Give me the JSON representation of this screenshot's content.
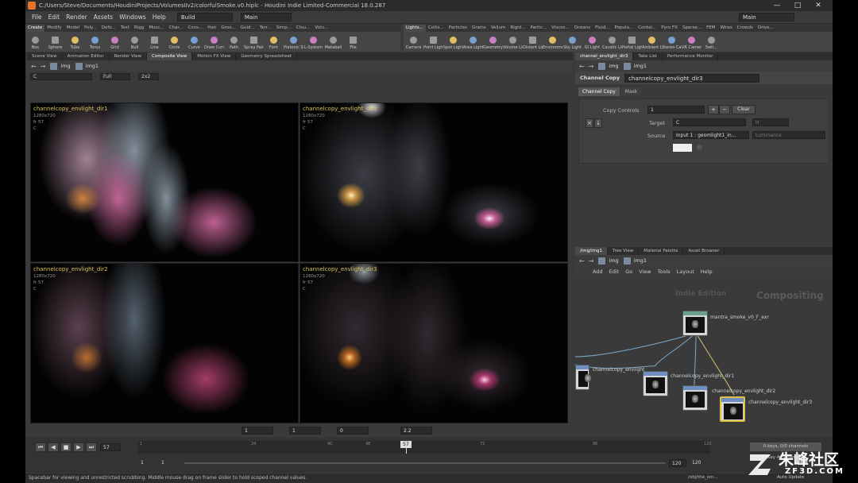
{
  "window": {
    "title": "C:/Users/Steve/Documents/HoudiniProjects/VolumesIIv2/colorfulSmoke.v0.hiplc - Houdini Indie Limited-Commercial 18.0.287",
    "minimize": "—",
    "maximize": "□",
    "close": "✕"
  },
  "menu": [
    "File",
    "Edit",
    "Render",
    "Assets",
    "Windows",
    "Help"
  ],
  "desktop_select": "Build",
  "main_select": "Main",
  "right_main": "Main",
  "shelf_left_tabs": [
    "Create",
    "Modify",
    "Model",
    "Poly...",
    "Defo...",
    "Text",
    "Rigg",
    "Musc...",
    "Char...",
    "Cons...",
    "Hair",
    "Groo...",
    "Guid...",
    "Terr...",
    "Simp...",
    "Clou...",
    "Volu..."
  ],
  "shelf_left_tools": [
    "Box",
    "Sphere",
    "Tube",
    "Torus",
    "Grid",
    "Null",
    "Line",
    "Circle",
    "Curve",
    "Draw Curve",
    "Path",
    "Spray Paint",
    "Font",
    "Platonic Solids",
    "L-System",
    "Metaball",
    "File"
  ],
  "shelf_right_tabs": [
    "Lights...",
    "Collis...",
    "Particles",
    "Grains",
    "Vellum",
    "Rigid...",
    "Partic...",
    "Viscos...",
    "Oceans",
    "Fluid...",
    "Popula...",
    "Contai...",
    "Pyro FX",
    "Sparse...",
    "FEM",
    "Wires",
    "Crowds",
    "Drive..."
  ],
  "shelf_right_tools": [
    "Camera",
    "Point Light",
    "Spot Light",
    "Area Light",
    "Geometry Light",
    "Volume Light",
    "Distant Light",
    "Environment Light",
    "Sky Light",
    "GI Light",
    "Caustic Light",
    "Portal Light",
    "Ambient Light",
    "Stereo Camera",
    "VR Camera",
    "Swit..."
  ],
  "viewer_tabs": [
    "Scene View",
    "Animation Editor",
    "Render View",
    "Composite View",
    "Motion FX View",
    "Geometry Spreadsheet"
  ],
  "viewer_path": [
    "img",
    "img1"
  ],
  "viewer_toolbar": {
    "channel": "C",
    "res": "Full",
    "layout": "2x2"
  },
  "quads": [
    {
      "label": "channelcopy_envlight_dir1",
      "res": "1280x720",
      "frame": "fr 57",
      "ch": "C"
    },
    {
      "label": "channelcopy_envlight_dir3",
      "res": "1280x720",
      "frame": "fr 57",
      "ch": "C"
    },
    {
      "label": "channelcopy_envlight_dir2",
      "res": "1280x720",
      "frame": "fr 57",
      "ch": "C"
    },
    {
      "label": "channelcopy_envlight_dir3",
      "res": "1280x720",
      "frame": "fr 57",
      "ch": "C"
    }
  ],
  "viewer_bottom": {
    "f1": "1",
    "f2": "1",
    "f3": "0",
    "gamma": "2.2"
  },
  "param_tabs_top": [
    "channel_envlight_dir3",
    "Take List",
    "Performance Monitor"
  ],
  "param_path": [
    "img",
    "img1"
  ],
  "param": {
    "node_type": "Channel Copy",
    "node_name": "channelcopy_envlight_dir3",
    "tabs": [
      "Channel Copy",
      "Mask"
    ],
    "copy_controls_label": "Copy Controls",
    "copy_controls_value": "1",
    "clear": "Clear",
    "target_label": "Target",
    "target_value": "C",
    "target_aux": "H",
    "source_label": "Source",
    "source_value": "Input 1 : geomlight1_in...",
    "source_aux": "Luminance"
  },
  "net_tabs": [
    "/img/img1",
    "Tree View",
    "Material Palette",
    "Asset Browser"
  ],
  "net_path": [
    "img",
    "img1"
  ],
  "net_menu": [
    "Add",
    "Edit",
    "Go",
    "View",
    "Tools",
    "Layout",
    "Help"
  ],
  "net_watermark_left": "Indie Edition",
  "net_watermark": "Compositing",
  "nodes": [
    {
      "name": "mantra_smoke_v0_F_exr"
    },
    {
      "name": "channelcopy_envlight"
    },
    {
      "name": "channelcopy_envlight_dir1"
    },
    {
      "name": "channelcopy_envlight_dir2"
    },
    {
      "name": "channelcopy_envlight_dir3"
    }
  ],
  "timeline": {
    "frame": "57",
    "marker": "57",
    "ticks": [
      "1",
      "24",
      "40",
      "48",
      "72",
      "96",
      "120"
    ],
    "start": "1",
    "start2": "1",
    "end": "120",
    "end2": "120",
    "keys_label": "0 keys, 0/0 channels",
    "key_all": "Key All Channels",
    "auto_update": "Auto Update",
    "obj_path": "/obj/the_sm..."
  },
  "statusbar": "Spacebar for viewing and unrestricted scrubbing. Middle mouse drag on frame slider to hold scoped channel values.",
  "brand_watermark": "朱峰社区",
  "brand_url": "ZF3D.COM"
}
